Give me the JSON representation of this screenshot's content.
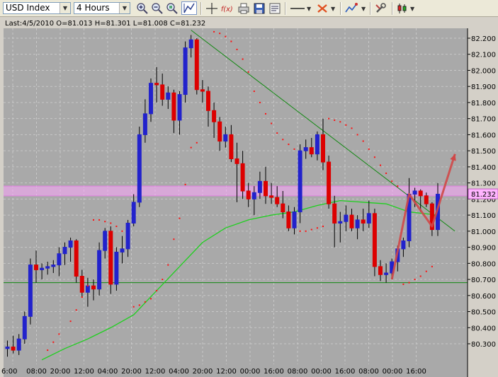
{
  "toolbar": {
    "symbol": "USD Index",
    "timeframe": "4 Hours",
    "icons": [
      "zoom-in-icon",
      "zoom-out-icon",
      "auto-scroll-icon",
      "chart-shift-icon",
      "crosshair-icon",
      "indicators-fx-icon",
      "print-icon",
      "save-icon",
      "properties-icon",
      "line-tool-icon",
      "objects-icon",
      "periodicity-icon",
      "settings-icon",
      "chart-type-icon"
    ]
  },
  "chart_data": {
    "type": "candlestick",
    "title": "Last:4/5/2010 O=81.013 H=81.301 L=81.008 C=81.232",
    "ylim": [
      80.2,
      82.28
    ],
    "y_ticks": [
      "82.200",
      "82.100",
      "82.000",
      "81.900",
      "81.800",
      "81.700",
      "81.600",
      "81.500",
      "81.400",
      "81.300",
      "81.200",
      "81.100",
      "81.000",
      "80.900",
      "80.800",
      "80.700",
      "80.600",
      "80.500",
      "80.400",
      "80.300"
    ],
    "x_ticks": [
      "6:00",
      "08:00",
      "20:00",
      "12:00",
      "04:00",
      "20:00",
      "12:00",
      "04:00",
      "20:00",
      "12:00",
      "00:00",
      "16:00",
      "08:00",
      "00:00",
      "16:00",
      "08:00",
      "00:00",
      "16:00"
    ],
    "last_price": 81.232,
    "last_price_label": "81.232",
    "colors": {
      "background": "#a9a9a9",
      "bull": "#2222cc",
      "bear": "#dd0000",
      "sar": "#ff1010",
      "ma": "#1ed01e",
      "horizontal_line": "#118811",
      "trend_line": "#118811",
      "resistance_band": "#ffa8ff",
      "zigzag": "#d04848",
      "last_price_badge": "#ffb4ff"
    },
    "candles": [
      {
        "o": 80.27,
        "h": 80.32,
        "l": 80.22,
        "c": 80.28
      },
      {
        "o": 80.28,
        "h": 80.35,
        "l": 80.24,
        "c": 80.26
      },
      {
        "o": 80.26,
        "h": 80.36,
        "l": 80.23,
        "c": 80.33
      },
      {
        "o": 80.33,
        "h": 80.5,
        "l": 80.3,
        "c": 80.47
      },
      {
        "o": 80.47,
        "h": 80.83,
        "l": 80.42,
        "c": 80.79
      },
      {
        "o": 80.79,
        "h": 80.88,
        "l": 80.68,
        "c": 80.76
      },
      {
        "o": 80.76,
        "h": 80.8,
        "l": 80.7,
        "c": 80.77
      },
      {
        "o": 80.77,
        "h": 80.81,
        "l": 80.73,
        "c": 80.78
      },
      {
        "o": 80.78,
        "h": 80.82,
        "l": 80.74,
        "c": 80.79
      },
      {
        "o": 80.79,
        "h": 80.9,
        "l": 80.72,
        "c": 80.86
      },
      {
        "o": 80.86,
        "h": 80.93,
        "l": 80.79,
        "c": 80.9
      },
      {
        "o": 80.9,
        "h": 80.96,
        "l": 80.81,
        "c": 80.94
      },
      {
        "o": 80.94,
        "h": 80.95,
        "l": 80.68,
        "c": 80.72
      },
      {
        "o": 80.72,
        "h": 80.76,
        "l": 80.59,
        "c": 80.62
      },
      {
        "o": 80.62,
        "h": 80.71,
        "l": 80.53,
        "c": 80.66
      },
      {
        "o": 80.66,
        "h": 80.7,
        "l": 80.57,
        "c": 80.64
      },
      {
        "o": 80.64,
        "h": 80.93,
        "l": 80.6,
        "c": 80.88
      },
      {
        "o": 80.88,
        "h": 81.02,
        "l": 80.83,
        "c": 81.0
      },
      {
        "o": 81.0,
        "h": 81.03,
        "l": 80.61,
        "c": 80.67
      },
      {
        "o": 80.67,
        "h": 80.9,
        "l": 80.63,
        "c": 80.87
      },
      {
        "o": 80.87,
        "h": 80.97,
        "l": 80.8,
        "c": 80.89
      },
      {
        "o": 80.89,
        "h": 81.07,
        "l": 80.84,
        "c": 81.05
      },
      {
        "o": 81.05,
        "h": 81.23,
        "l": 81.03,
        "c": 81.18
      },
      {
        "o": 81.18,
        "h": 81.65,
        "l": 81.15,
        "c": 81.6
      },
      {
        "o": 81.6,
        "h": 81.82,
        "l": 81.55,
        "c": 81.73
      },
      {
        "o": 81.73,
        "h": 81.95,
        "l": 81.68,
        "c": 81.92
      },
      {
        "o": 81.92,
        "h": 82.02,
        "l": 81.8,
        "c": 81.91
      },
      {
        "o": 81.91,
        "h": 81.98,
        "l": 81.78,
        "c": 81.82
      },
      {
        "o": 81.82,
        "h": 81.9,
        "l": 81.76,
        "c": 81.86
      },
      {
        "o": 81.86,
        "h": 81.88,
        "l": 81.61,
        "c": 81.69
      },
      {
        "o": 81.69,
        "h": 81.87,
        "l": 81.6,
        "c": 81.85
      },
      {
        "o": 81.85,
        "h": 82.18,
        "l": 81.8,
        "c": 82.14
      },
      {
        "o": 82.14,
        "h": 82.22,
        "l": 82.08,
        "c": 82.19
      },
      {
        "o": 82.19,
        "h": 82.2,
        "l": 81.85,
        "c": 81.88
      },
      {
        "o": 81.88,
        "h": 81.94,
        "l": 81.8,
        "c": 81.87
      },
      {
        "o": 81.87,
        "h": 81.9,
        "l": 81.65,
        "c": 81.75
      },
      {
        "o": 81.75,
        "h": 81.8,
        "l": 81.58,
        "c": 81.68
      },
      {
        "o": 81.68,
        "h": 81.71,
        "l": 81.5,
        "c": 81.56
      },
      {
        "o": 81.56,
        "h": 81.65,
        "l": 81.52,
        "c": 81.6
      },
      {
        "o": 81.6,
        "h": 81.66,
        "l": 81.43,
        "c": 81.45
      },
      {
        "o": 81.45,
        "h": 81.55,
        "l": 81.18,
        "c": 81.42
      },
      {
        "o": 81.42,
        "h": 81.5,
        "l": 81.2,
        "c": 81.25
      },
      {
        "o": 81.25,
        "h": 81.3,
        "l": 81.15,
        "c": 81.2
      },
      {
        "o": 81.2,
        "h": 81.28,
        "l": 81.1,
        "c": 81.24
      },
      {
        "o": 81.24,
        "h": 81.37,
        "l": 81.2,
        "c": 81.31
      },
      {
        "o": 81.31,
        "h": 81.4,
        "l": 81.17,
        "c": 81.22
      },
      {
        "o": 81.22,
        "h": 81.3,
        "l": 81.17,
        "c": 81.21
      },
      {
        "o": 81.21,
        "h": 81.28,
        "l": 81.15,
        "c": 81.17
      },
      {
        "o": 81.17,
        "h": 81.25,
        "l": 81.08,
        "c": 81.12
      },
      {
        "o": 81.12,
        "h": 81.16,
        "l": 81.0,
        "c": 81.02
      },
      {
        "o": 81.02,
        "h": 81.15,
        "l": 80.98,
        "c": 81.12
      },
      {
        "o": 81.12,
        "h": 81.54,
        "l": 81.05,
        "c": 81.5
      },
      {
        "o": 81.5,
        "h": 81.57,
        "l": 81.45,
        "c": 81.52
      },
      {
        "o": 81.52,
        "h": 81.58,
        "l": 81.46,
        "c": 81.48
      },
      {
        "o": 81.48,
        "h": 81.62,
        "l": 81.44,
        "c": 81.6
      },
      {
        "o": 81.6,
        "h": 81.7,
        "l": 81.38,
        "c": 81.43
      },
      {
        "o": 81.43,
        "h": 81.47,
        "l": 81.14,
        "c": 81.17
      },
      {
        "o": 81.17,
        "h": 81.22,
        "l": 80.9,
        "c": 81.05
      },
      {
        "o": 81.05,
        "h": 81.12,
        "l": 80.93,
        "c": 81.06
      },
      {
        "o": 81.06,
        "h": 81.16,
        "l": 81.0,
        "c": 81.1
      },
      {
        "o": 81.1,
        "h": 81.14,
        "l": 81.0,
        "c": 81.02
      },
      {
        "o": 81.02,
        "h": 81.1,
        "l": 80.95,
        "c": 81.07
      },
      {
        "o": 81.07,
        "h": 81.14,
        "l": 81.0,
        "c": 81.05
      },
      {
        "o": 81.05,
        "h": 81.19,
        "l": 81.02,
        "c": 81.11
      },
      {
        "o": 81.11,
        "h": 81.14,
        "l": 80.72,
        "c": 80.78
      },
      {
        "o": 80.78,
        "h": 80.82,
        "l": 80.69,
        "c": 80.73
      },
      {
        "o": 80.73,
        "h": 80.8,
        "l": 80.68,
        "c": 80.74
      },
      {
        "o": 80.74,
        "h": 80.83,
        "l": 80.7,
        "c": 80.81
      },
      {
        "o": 80.81,
        "h": 80.91,
        "l": 80.75,
        "c": 80.89
      },
      {
        "o": 80.89,
        "h": 80.96,
        "l": 80.84,
        "c": 80.94
      },
      {
        "o": 80.94,
        "h": 81.33,
        "l": 80.9,
        "c": 81.23
      },
      {
        "o": 81.23,
        "h": 81.27,
        "l": 81.15,
        "c": 81.25
      },
      {
        "o": 81.25,
        "h": 81.26,
        "l": 81.12,
        "c": 81.22
      },
      {
        "o": 81.22,
        "h": 81.24,
        "l": 81.15,
        "c": 81.17
      },
      {
        "o": 81.17,
        "h": 81.18,
        "l": 80.97,
        "c": 81.01
      },
      {
        "o": 81.01,
        "h": 81.3,
        "l": 80.97,
        "c": 81.23
      }
    ],
    "parabolic_sar": [
      [
        7,
        80.26
      ],
      [
        8,
        80.31
      ],
      [
        9,
        80.36
      ],
      [
        11,
        80.44
      ],
      [
        12,
        80.51
      ],
      [
        13,
        80.59
      ],
      [
        14,
        80.66
      ],
      [
        15,
        81.07
      ],
      [
        16,
        81.07
      ],
      [
        17,
        81.06
      ],
      [
        18,
        81.05
      ],
      [
        19,
        81.03
      ],
      [
        20,
        81.0
      ],
      [
        22,
        80.53
      ],
      [
        23,
        80.54
      ],
      [
        24,
        80.56
      ],
      [
        25,
        80.58
      ],
      [
        26,
        80.63
      ],
      [
        27,
        80.7
      ],
      [
        28,
        80.79
      ],
      [
        29,
        80.95
      ],
      [
        30,
        81.08
      ],
      [
        31,
        81.29
      ],
      [
        32,
        81.52
      ],
      [
        33,
        81.55
      ],
      [
        36,
        82.24
      ],
      [
        37,
        82.23
      ],
      [
        38,
        82.21
      ],
      [
        39,
        82.18
      ],
      [
        40,
        82.13
      ],
      [
        41,
        82.07
      ],
      [
        42,
        81.99
      ],
      [
        43,
        81.87
      ],
      [
        44,
        81.8
      ],
      [
        45,
        81.73
      ],
      [
        46,
        81.67
      ],
      [
        47,
        81.61
      ],
      [
        48,
        81.57
      ],
      [
        49,
        81.54
      ],
      [
        50,
        81.51
      ],
      [
        51,
        81.0
      ],
      [
        52,
        81.0
      ],
      [
        53,
        81.01
      ],
      [
        54,
        81.02
      ],
      [
        55,
        81.03
      ],
      [
        56,
        81.7
      ],
      [
        57,
        81.69
      ],
      [
        58,
        81.68
      ],
      [
        59,
        81.66
      ],
      [
        60,
        81.64
      ],
      [
        61,
        81.6
      ],
      [
        62,
        81.56
      ],
      [
        63,
        81.51
      ],
      [
        64,
        81.46
      ],
      [
        65,
        81.41
      ],
      [
        66,
        81.36
      ],
      [
        67,
        81.31
      ],
      [
        68,
        81.28
      ],
      [
        69,
        80.67
      ],
      [
        70,
        80.68
      ],
      [
        71,
        80.7
      ],
      [
        72,
        80.72
      ],
      [
        73,
        80.75
      ],
      [
        74,
        80.78
      ]
    ],
    "moving_average": [
      [
        6,
        80.2
      ],
      [
        10,
        80.27
      ],
      [
        14,
        80.33
      ],
      [
        18,
        80.4
      ],
      [
        22,
        80.48
      ],
      [
        26,
        80.63
      ],
      [
        30,
        80.78
      ],
      [
        34,
        80.93
      ],
      [
        38,
        81.02
      ],
      [
        42,
        81.07
      ],
      [
        46,
        81.1
      ],
      [
        50,
        81.12
      ],
      [
        54,
        81.16
      ],
      [
        58,
        81.19
      ],
      [
        62,
        81.18
      ],
      [
        66,
        81.17
      ],
      [
        70,
        81.12
      ],
      [
        75,
        81.1
      ]
    ],
    "horizontal_line": 80.68,
    "resistance_band": [
      81.22,
      81.28
    ],
    "trend_line": [
      [
        32,
        82.25
      ],
      [
        78,
        81.0
      ]
    ],
    "zigzag": [
      [
        67,
        80.7
      ],
      [
        70,
        81.23
      ],
      [
        74,
        81.03
      ],
      [
        78,
        81.48
      ]
    ]
  }
}
